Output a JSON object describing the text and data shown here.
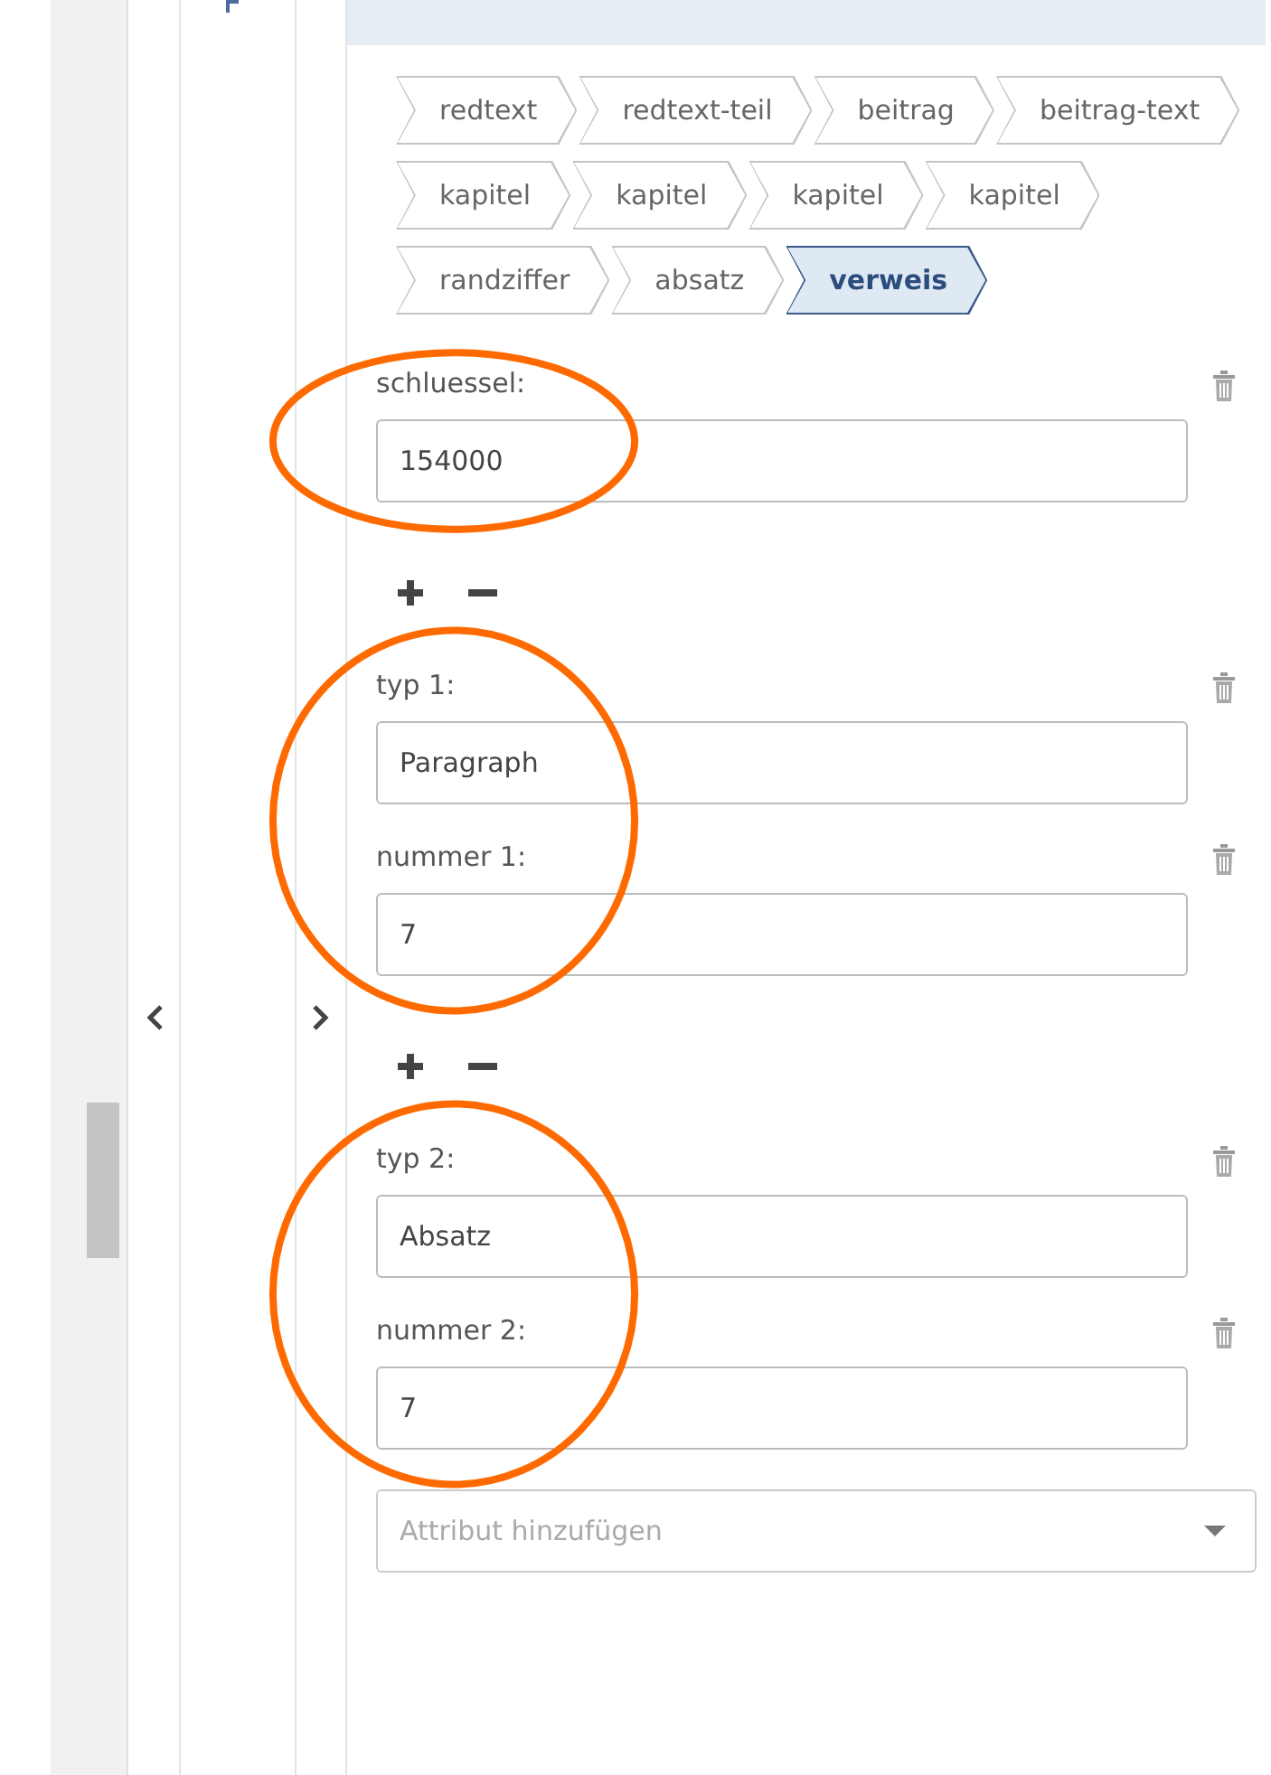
{
  "breadcrumb": [
    {
      "label": "redtext",
      "selected": false
    },
    {
      "label": "redtext-teil",
      "selected": false
    },
    {
      "label": "beitrag",
      "selected": false
    },
    {
      "label": "beitrag-text",
      "selected": false
    },
    {
      "label": "kapitel",
      "selected": false
    },
    {
      "label": "kapitel",
      "selected": false
    },
    {
      "label": "kapitel",
      "selected": false
    },
    {
      "label": "kapitel",
      "selected": false
    },
    {
      "label": "randziffer",
      "selected": false
    },
    {
      "label": "absatz",
      "selected": false
    },
    {
      "label": "verweis",
      "selected": true
    }
  ],
  "groups": [
    {
      "circled": true,
      "attributes": [
        {
          "label": "schluessel:",
          "value": "154000"
        }
      ]
    },
    {
      "circled": true,
      "attributes": [
        {
          "label": "typ 1:",
          "value": "Paragraph"
        },
        {
          "label": "nummer 1:",
          "value": "7"
        }
      ]
    },
    {
      "circled": true,
      "attributes": [
        {
          "label": "typ 2:",
          "value": "Absatz"
        },
        {
          "label": "nummer 2:",
          "value": "7"
        }
      ]
    }
  ],
  "add_attribute": {
    "placeholder": "Attribut hinzufügen"
  }
}
